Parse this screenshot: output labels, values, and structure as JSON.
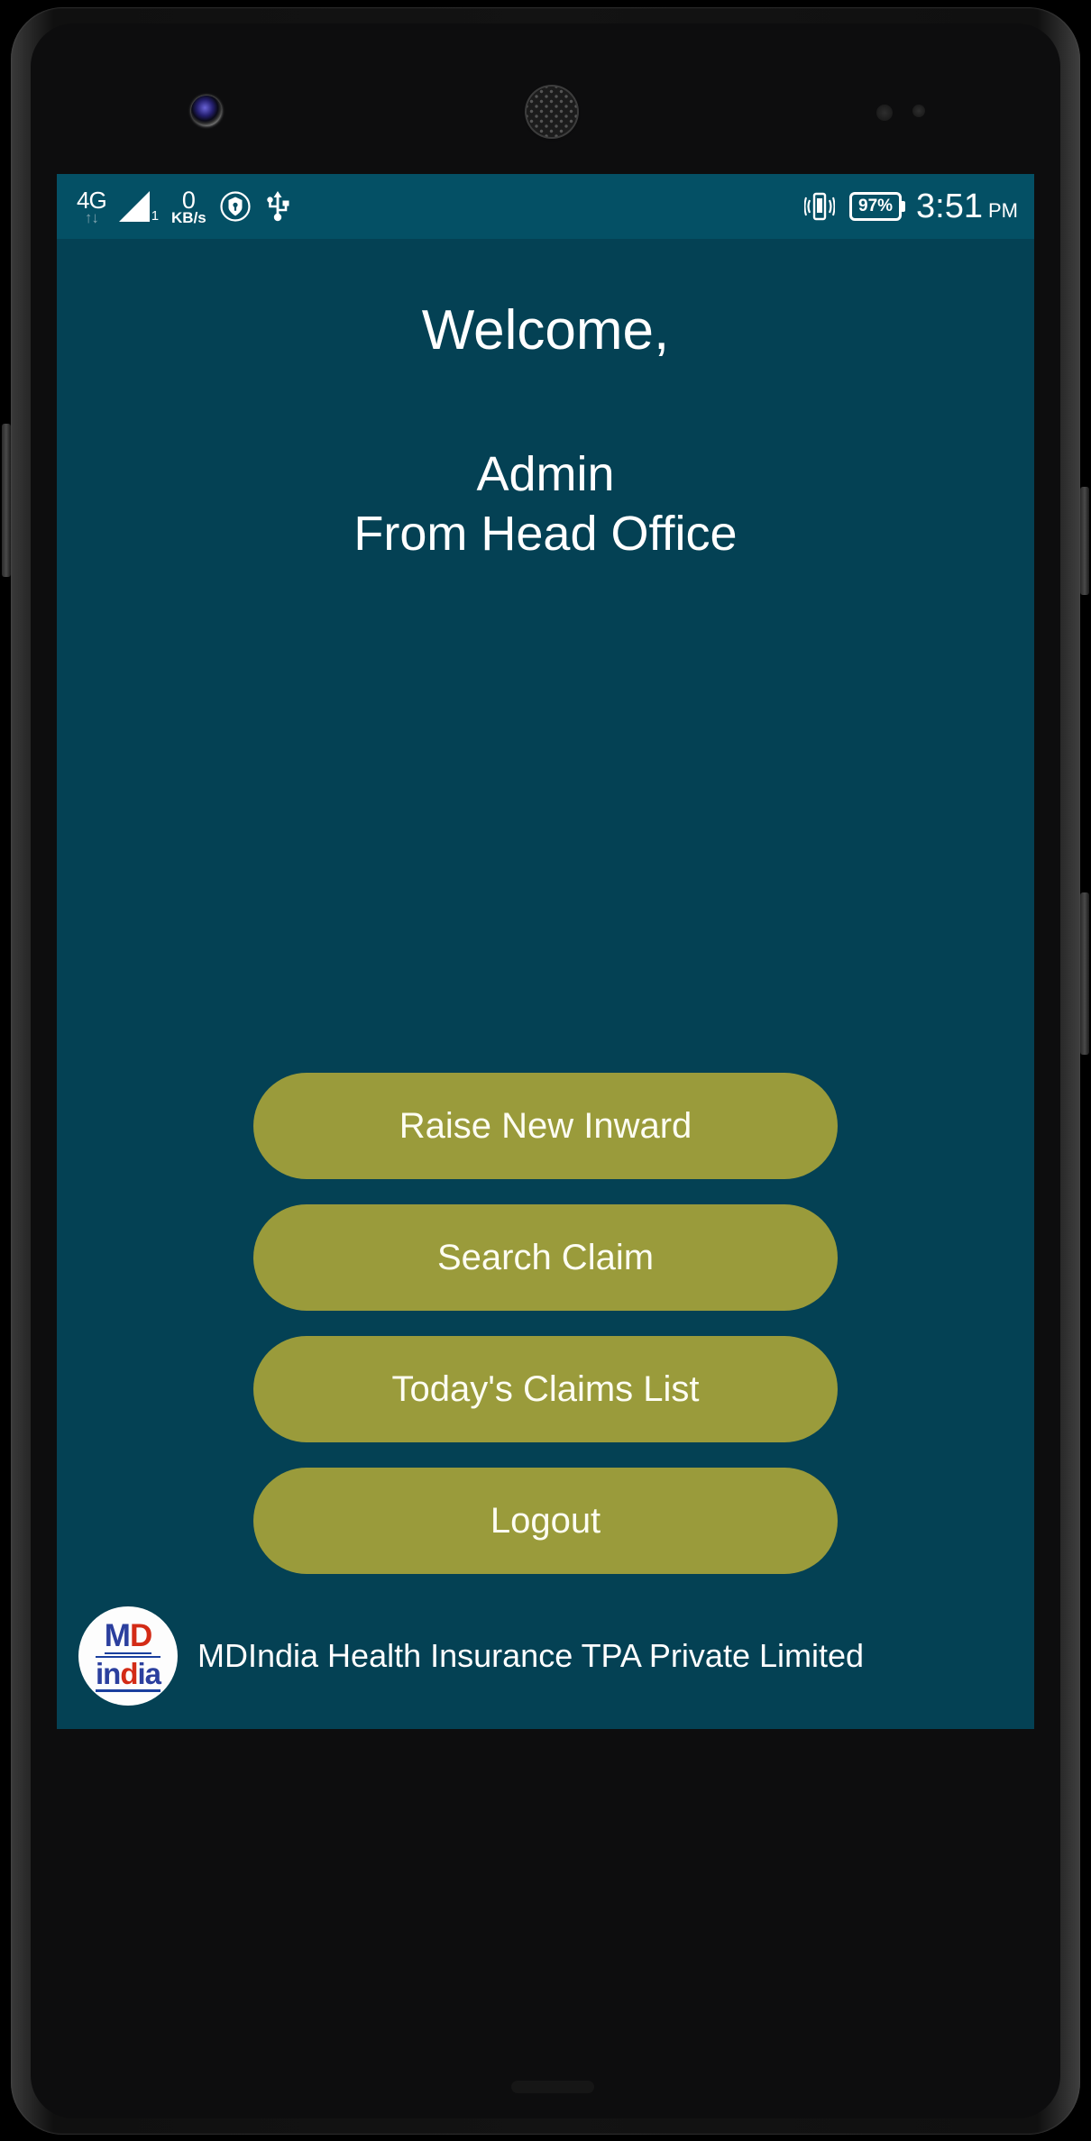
{
  "statusbar": {
    "network_type": "4G",
    "data_arrows": "↑↓",
    "signal_sim": "1",
    "data_speed_value": "0",
    "data_speed_unit": "KB/s",
    "vpn_icon": "shield-key-icon",
    "usb_icon": "usb-icon",
    "vibrate_icon": "vibrate-icon",
    "battery_percent": "97%",
    "time": "3:51",
    "meridiem": "PM"
  },
  "screen": {
    "welcome_title": "Welcome,",
    "user_name": "Admin",
    "user_location": "From Head Office"
  },
  "actions": [
    {
      "label": "Raise New Inward",
      "name": "raise-new-inward-button"
    },
    {
      "label": "Search Claim",
      "name": "search-claim-button"
    },
    {
      "label": "Today's Claims List",
      "name": "todays-claims-list-button"
    },
    {
      "label": "Logout",
      "name": "logout-button"
    }
  ],
  "footer": {
    "company": "MDIndia Health Insurance TPA Private Limited",
    "logo": {
      "line1_part1": "MD",
      "line1_m": "M",
      "line1_d": "D",
      "line2_in": "in",
      "line2_d": "d",
      "line2_ia": "ia"
    }
  },
  "colors": {
    "background": "#044154",
    "statusbar": "#045065",
    "button": "#9a9b3b",
    "button_text": "#fdfdf2",
    "text": "#ffffff",
    "logo_blue": "#2b3f9e",
    "logo_red": "#d32b16"
  }
}
